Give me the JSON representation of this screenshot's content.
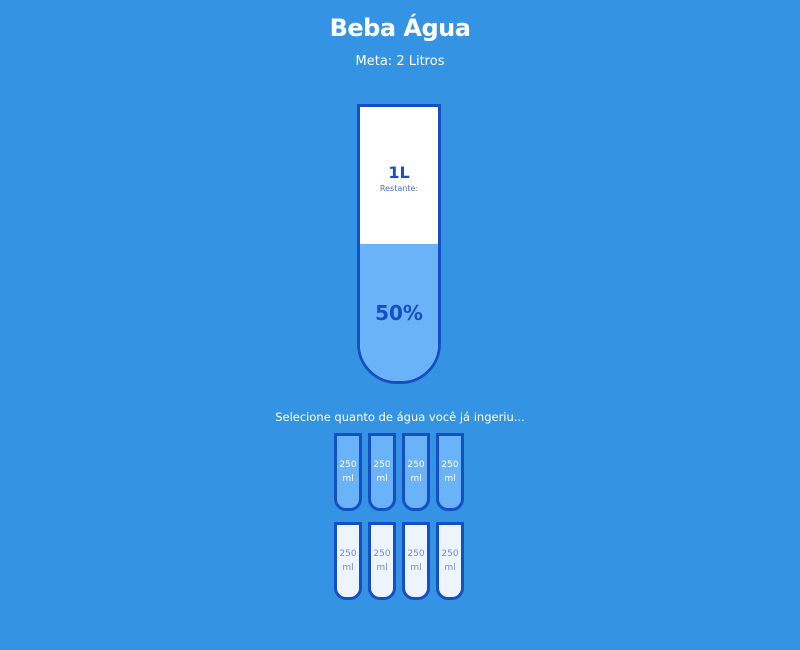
{
  "header": {
    "title": "Beba Água",
    "goal": "Meta: 2 Litros"
  },
  "main_cup": {
    "remaining_liters": "1L",
    "remaining_label": "Restante:",
    "percentage_label": "50%",
    "fill_fraction": 0.5
  },
  "instruction": "Selecione quanto de água você já ingeriu...",
  "cups": [
    {
      "amount": "250",
      "unit": "ml",
      "filled": true
    },
    {
      "amount": "250",
      "unit": "ml",
      "filled": true
    },
    {
      "amount": "250",
      "unit": "ml",
      "filled": true
    },
    {
      "amount": "250",
      "unit": "ml",
      "filled": true
    },
    {
      "amount": "250",
      "unit": "ml",
      "filled": false
    },
    {
      "amount": "250",
      "unit": "ml",
      "filled": false
    },
    {
      "amount": "250",
      "unit": "ml",
      "filled": false
    },
    {
      "amount": "250",
      "unit": "ml",
      "filled": false
    }
  ],
  "colors": {
    "background": "#3494e3",
    "accent": "#144fc6",
    "fill": "#6ab3f8",
    "cup_empty": "#eef4fc"
  }
}
